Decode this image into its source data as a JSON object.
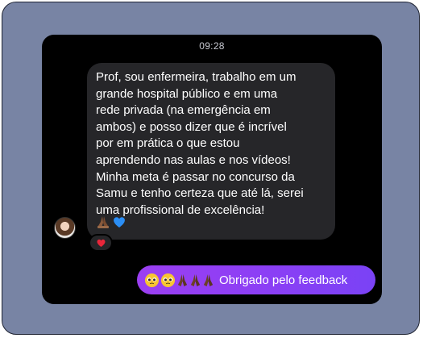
{
  "chat": {
    "timestamp": "09:28",
    "incoming_message": {
      "text": "Prof, sou enfermeira, trabalho em um\ngrande hospital público e em uma\nrede privada (na emergência em\nambos) e posso dizer que é incrível\npor em prática o que estou\naprendendo nas aulas e nos vídeos!\nMinha meta é passar no concurso da\nSamu e tenho certeza que até lá, serei\numa profissional de excelência!",
      "emojis": [
        "folded-hands-icon",
        "blue-heart-icon"
      ],
      "reaction": "red-heart-icon"
    },
    "outgoing_message": {
      "emojis": [
        "pleading-face-icon",
        "pleading-face-icon",
        "folded-hands-icon",
        "folded-hands-icon",
        "folded-hands-icon"
      ],
      "text": "Obrigado pelo feedback"
    }
  },
  "colors": {
    "frame_bg": "#7884a4",
    "chat_bg": "#000000",
    "incoming_bubble": "#262629",
    "outgoing_bubble": "#8b3ff5"
  }
}
